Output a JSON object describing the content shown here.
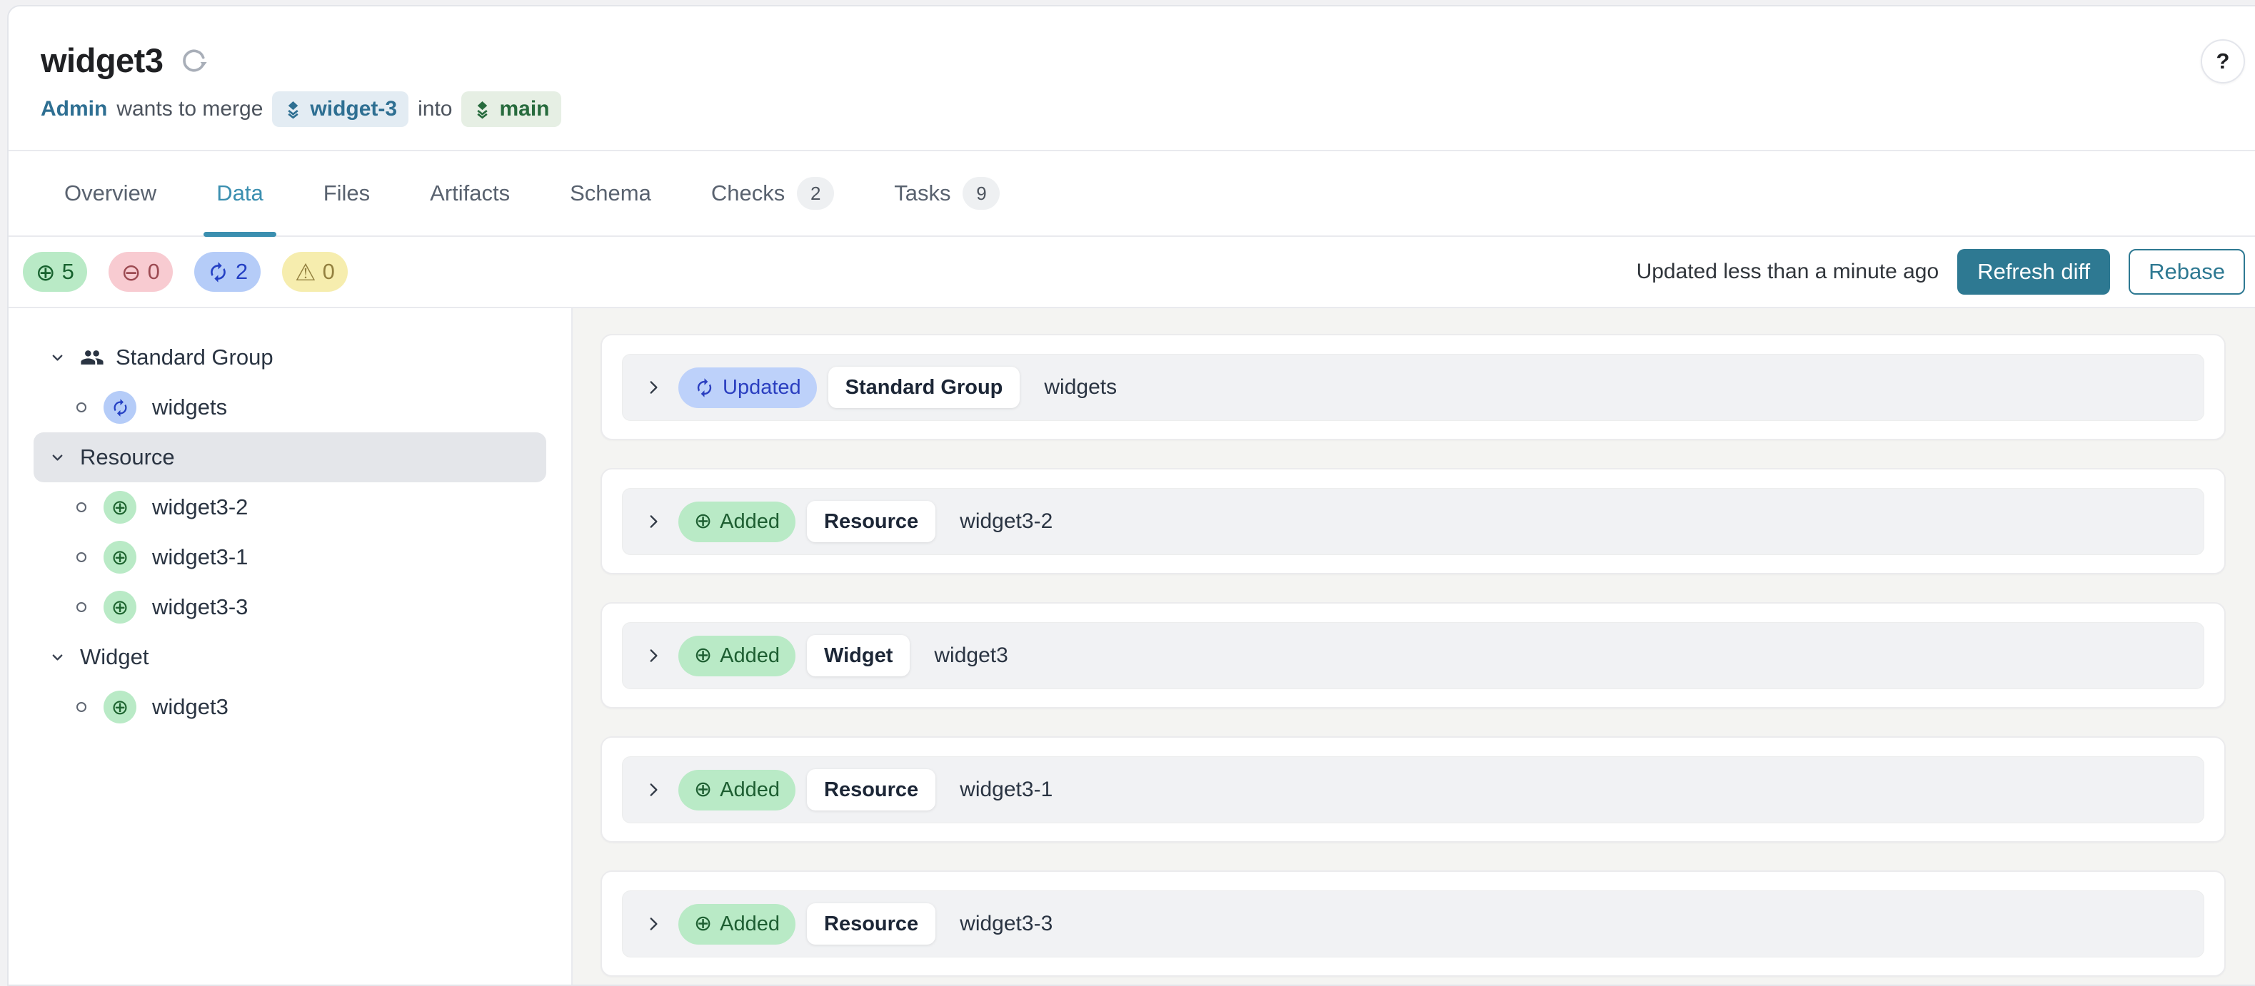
{
  "colors": {
    "accent_teal": "#2e7992",
    "active_tab": "#3b8fb0",
    "added_bg": "#b9eac6",
    "added_fg": "#1d5e31",
    "removed_bg": "#f8cbd1",
    "removed_fg": "#9c4a52",
    "modified_bg": "#b5ccf8",
    "modified_fg": "#2440c4",
    "warning_bg": "#f6edae",
    "warning_fg": "#93803f",
    "source_branch_bg": "#e3ecf3",
    "source_branch_fg": "#2e6f92",
    "target_branch_bg": "#e6efe4",
    "target_branch_fg": "#276b3d"
  },
  "icons": {
    "plus_circle": "⊕",
    "minus_circle": "⊖",
    "warning": "⚠"
  },
  "header": {
    "title": "widget3",
    "help_label": "?",
    "author": "Admin",
    "action_text": "wants to merge",
    "source_branch": "widget-3",
    "into_text": "into",
    "target_branch": "main"
  },
  "tabs": {
    "active": "Data",
    "items": [
      {
        "label": "Overview"
      },
      {
        "label": "Data"
      },
      {
        "label": "Files"
      },
      {
        "label": "Artifacts"
      },
      {
        "label": "Schema"
      },
      {
        "label": "Checks",
        "count": "2"
      },
      {
        "label": "Tasks",
        "count": "9"
      }
    ]
  },
  "toolbar": {
    "stats": {
      "added": "5",
      "removed": "0",
      "modified": "2",
      "warnings": "0"
    },
    "updated_text": "Updated less than a minute ago",
    "refresh_diff_label": "Refresh diff",
    "rebase_label": "Rebase"
  },
  "sidebar": {
    "items": [
      {
        "kind": "group",
        "label": "Standard Group",
        "icon": "users-icon"
      },
      {
        "kind": "leaf",
        "label": "widgets",
        "change": "updated"
      },
      {
        "kind": "group",
        "label": "Resource",
        "selected": true
      },
      {
        "kind": "leaf",
        "label": "widget3-2",
        "change": "added"
      },
      {
        "kind": "leaf",
        "label": "widget3-1",
        "change": "added"
      },
      {
        "kind": "leaf",
        "label": "widget3-3",
        "change": "added"
      },
      {
        "kind": "group",
        "label": "Widget"
      },
      {
        "kind": "leaf",
        "label": "widget3",
        "change": "added"
      }
    ]
  },
  "diff": {
    "rows": [
      {
        "status": "Updated",
        "type": "Standard Group",
        "name": "widgets"
      },
      {
        "status": "Added",
        "type": "Resource",
        "name": "widget3-2"
      },
      {
        "status": "Added",
        "type": "Widget",
        "name": "widget3"
      },
      {
        "status": "Added",
        "type": "Resource",
        "name": "widget3-1"
      },
      {
        "status": "Added",
        "type": "Resource",
        "name": "widget3-3"
      }
    ]
  }
}
